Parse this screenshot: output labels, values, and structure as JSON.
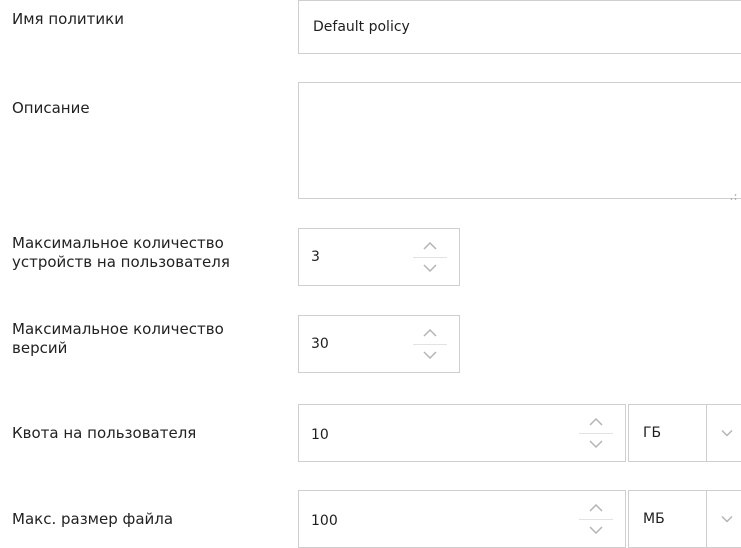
{
  "policy_name": {
    "label": "Имя политики",
    "value": "Default policy"
  },
  "description": {
    "label": "Описание",
    "value": ""
  },
  "max_devices": {
    "label_line1": "Максимальное количество",
    "label_line2": "устройств на пользователя",
    "value": "3"
  },
  "max_versions": {
    "label_line1": "Максимальное количество",
    "label_line2": "версий",
    "value": "30"
  },
  "user_quota": {
    "label": "Квота на пользователя",
    "value": "10",
    "unit": "ГБ"
  },
  "max_file_size": {
    "label": "Макс. размер файла",
    "value": "100",
    "unit": "МБ"
  },
  "icons": {
    "spin_up": "chevron-up-icon",
    "spin_down": "chevron-down-icon",
    "dropdown": "chevron-down-icon",
    "resize": "resize-grip-icon"
  },
  "colors": {
    "border": "#cfcfcf",
    "text": "#222222",
    "arrow": "#b5b5b5"
  }
}
